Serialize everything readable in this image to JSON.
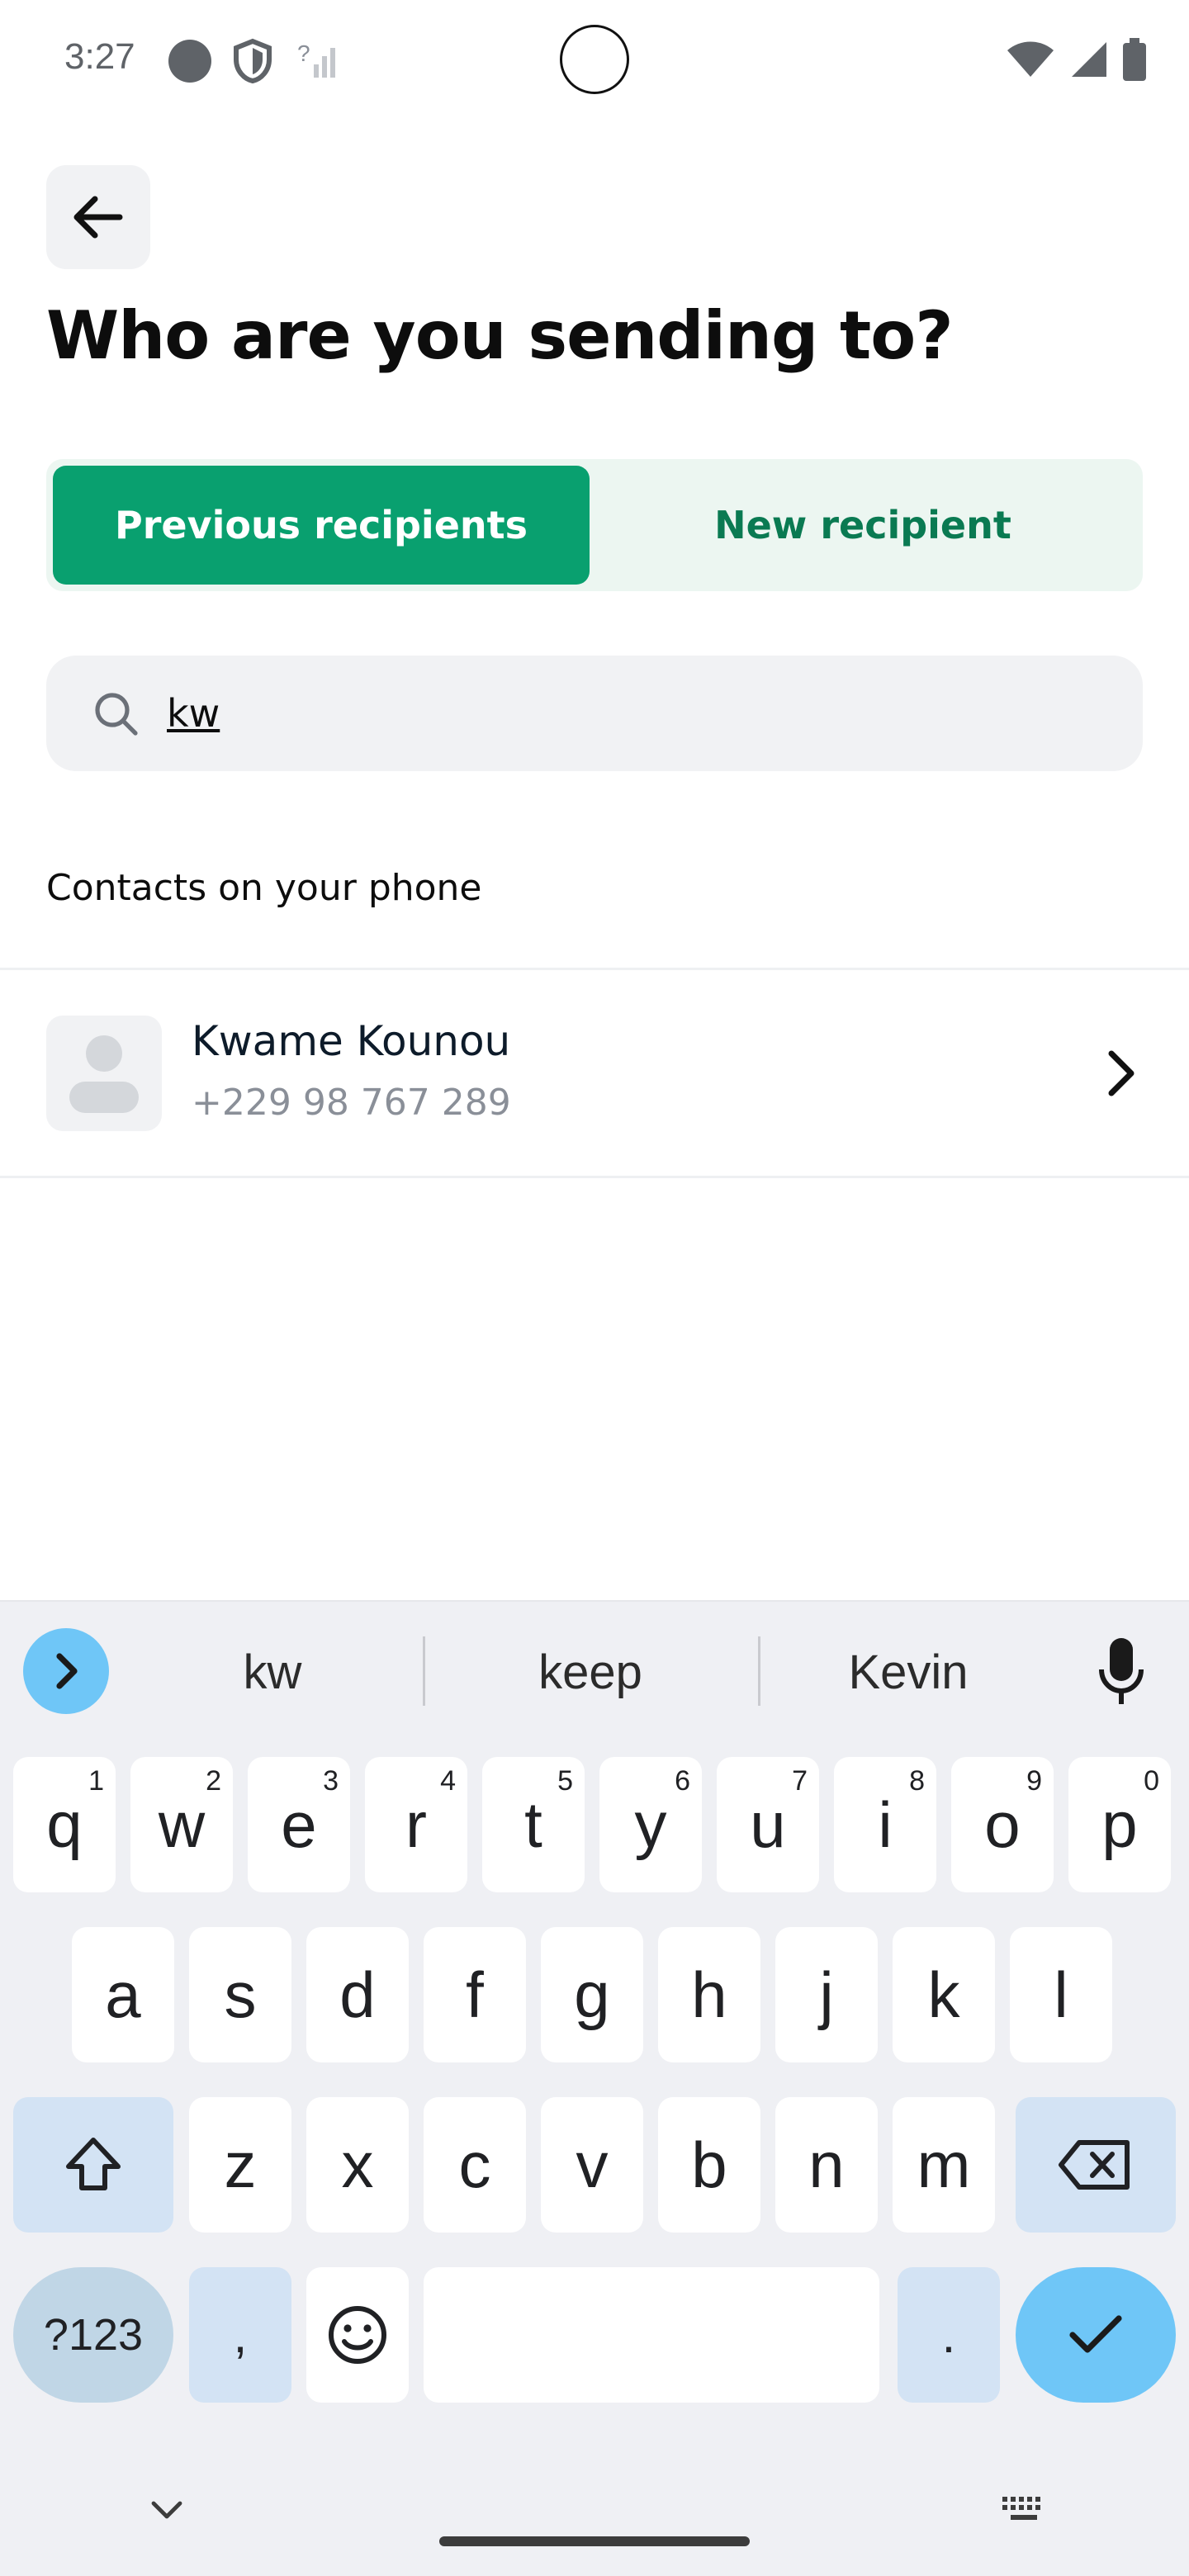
{
  "status_bar": {
    "time": "3:27"
  },
  "header": {
    "title": "Who are you sending to?"
  },
  "tabs": {
    "active_label": "Previous recipients",
    "inactive_label": "New recipient"
  },
  "search": {
    "value": "kw"
  },
  "contacts_section": {
    "label": "Contacts on your phone",
    "items": [
      {
        "name": "Kwame Kounou",
        "phone": "+229 98 767 289"
      }
    ]
  },
  "keyboard": {
    "suggestions": [
      "kw",
      "keep",
      "Kevin"
    ],
    "row1": [
      {
        "k": "q",
        "n": "1"
      },
      {
        "k": "w",
        "n": "2"
      },
      {
        "k": "e",
        "n": "3"
      },
      {
        "k": "r",
        "n": "4"
      },
      {
        "k": "t",
        "n": "5"
      },
      {
        "k": "y",
        "n": "6"
      },
      {
        "k": "u",
        "n": "7"
      },
      {
        "k": "i",
        "n": "8"
      },
      {
        "k": "o",
        "n": "9"
      },
      {
        "k": "p",
        "n": "0"
      }
    ],
    "row2": [
      "a",
      "s",
      "d",
      "f",
      "g",
      "h",
      "j",
      "k",
      "l"
    ],
    "row3": [
      "z",
      "x",
      "c",
      "v",
      "b",
      "n",
      "m"
    ],
    "symbols_label": "?123",
    "comma": ",",
    "period": "."
  }
}
